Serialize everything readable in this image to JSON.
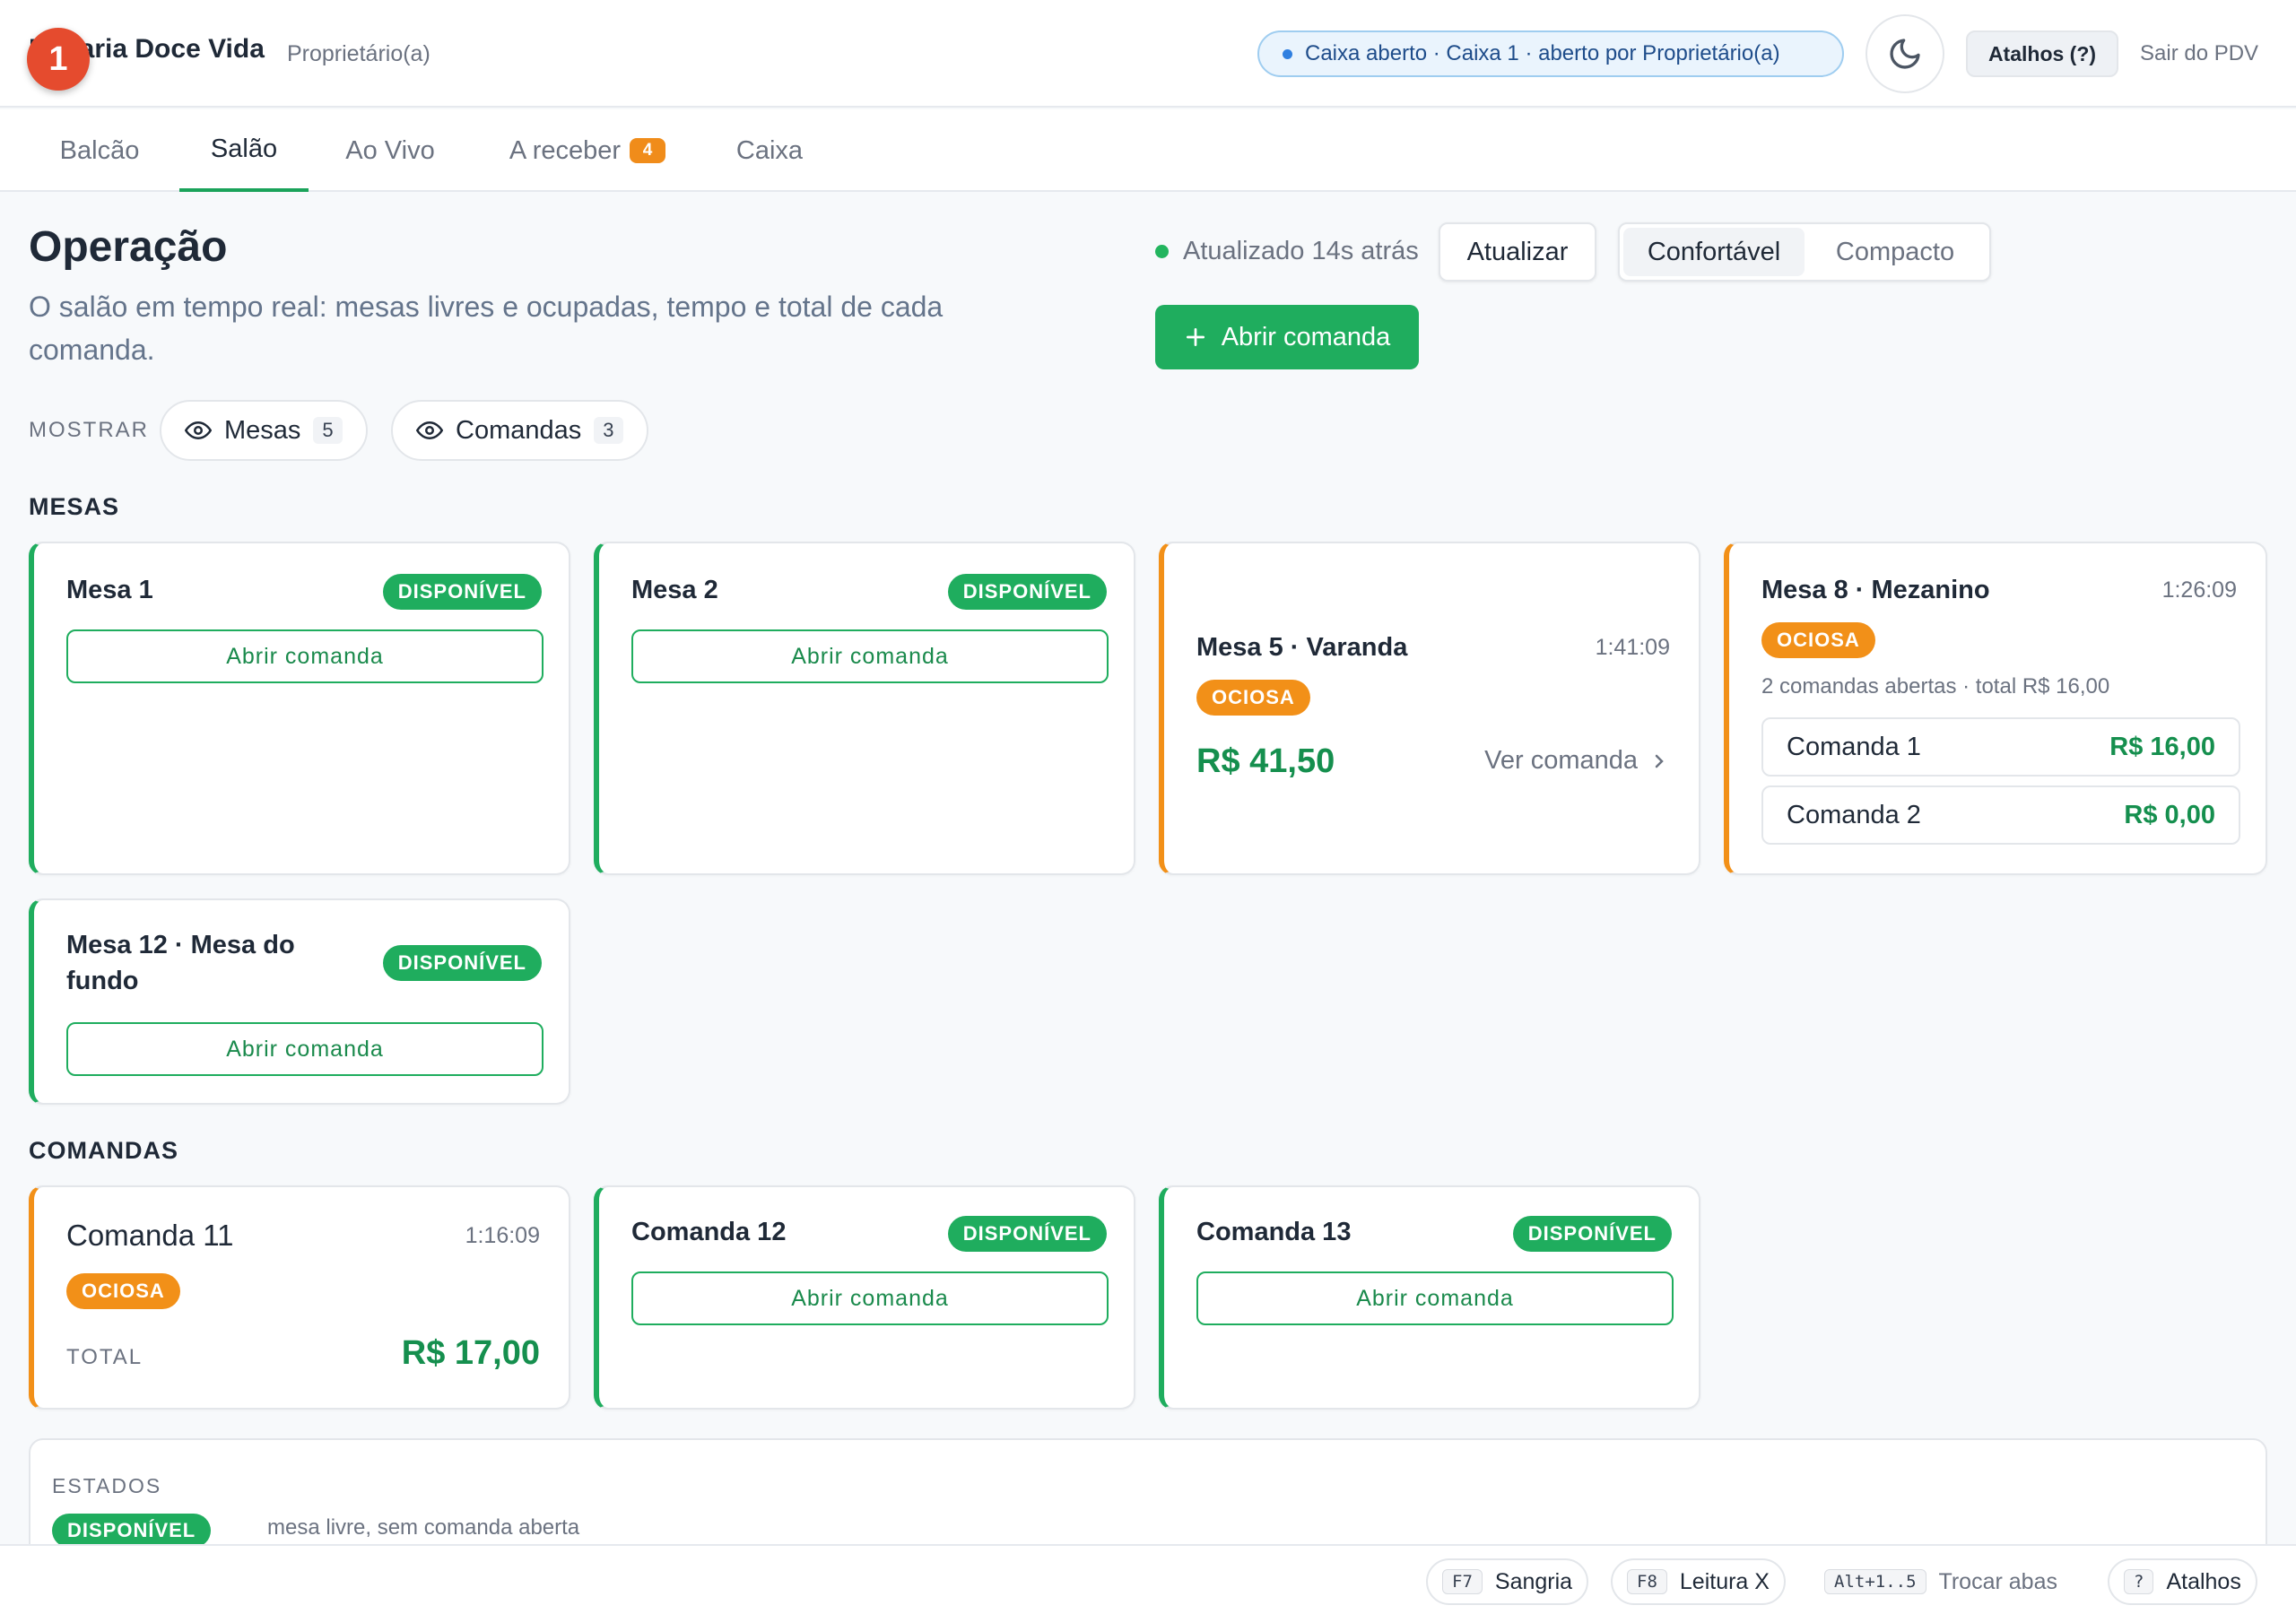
{
  "header": {
    "notification_count": "1",
    "brand": "Doçaria Doce Vida",
    "role": "Proprietário(a)",
    "caixa_status": "Caixa aberto · Caixa 1 · aberto por Proprietário(a)",
    "shortcuts_label": "Atalhos (?)",
    "logout_label": "Sair do PDV",
    "theme_icon": "moon-icon"
  },
  "tabs": [
    {
      "label": "Balcão"
    },
    {
      "label": "Salão",
      "active": true
    },
    {
      "label": "Ao Vivo"
    },
    {
      "label": "A receber",
      "badge": "4"
    },
    {
      "label": "Caixa"
    }
  ],
  "main": {
    "title": "Operação",
    "subtitle": "O salão em tempo real: mesas livres e ocupadas, tempo e total de cada comanda.",
    "updated": "Atualizado 14s atrás",
    "refresh_label": "Atualizar",
    "density": {
      "comfortable": "Confortável",
      "compact": "Compacto",
      "selected": "Confortável"
    },
    "open_button": "Abrir comanda",
    "show_label": "MOSTRAR",
    "filters": [
      {
        "label": "Mesas",
        "count": "5"
      },
      {
        "label": "Comandas",
        "count": "3"
      }
    ]
  },
  "mesas_section": "MESAS",
  "mesas": [
    {
      "title": "Mesa 1",
      "status": "DISPONÍVEL",
      "action": "Abrir comanda"
    },
    {
      "title": "Mesa 2",
      "status": "DISPONÍVEL",
      "action": "Abrir comanda"
    },
    {
      "title": "Mesa 5 · Varanda",
      "status": "OCIOSA",
      "timer": "1:41:09",
      "total": "R$ 41,50",
      "link": "Ver comanda"
    },
    {
      "title": "Mesa 8 · Mezanino",
      "status": "OCIOSA",
      "timer": "1:26:09",
      "summary": "2 comandas abertas · total R$ 16,00",
      "comandas": [
        {
          "name": "Comanda 1",
          "value": "R$ 16,00"
        },
        {
          "name": "Comanda 2",
          "value": "R$ 0,00"
        }
      ]
    },
    {
      "title": "Mesa 12 · Mesa do fundo",
      "status": "DISPONÍVEL",
      "action": "Abrir comanda"
    }
  ],
  "comandas_section": "COMANDAS",
  "comandas": [
    {
      "title": "Comanda 11",
      "status": "OCIOSA",
      "timer": "1:16:09",
      "total_label": "TOTAL",
      "total": "R$ 17,00"
    },
    {
      "title": "Comanda 12",
      "status": "DISPONÍVEL",
      "action": "Abrir comanda"
    },
    {
      "title": "Comanda 13",
      "status": "DISPONÍVEL",
      "action": "Abrir comanda"
    }
  ],
  "legend": {
    "title": "ESTADOS",
    "items": [
      {
        "status": "DISPONÍVEL",
        "desc": "mesa livre, sem comanda aberta"
      }
    ]
  },
  "footer": {
    "sangria": {
      "key": "F7",
      "label": "Sangria"
    },
    "leitura": {
      "key": "F8",
      "label": "Leitura X"
    },
    "trocar": {
      "key": "Alt+1..5",
      "label": "Trocar abas"
    },
    "atalhos": {
      "key": "?",
      "label": "Atalhos"
    }
  },
  "colors": {
    "accent_green": "#1fad5e",
    "warning_orange": "#f29018",
    "notification_red": "#e54b2e",
    "info_blue": "#2f7fe0"
  }
}
